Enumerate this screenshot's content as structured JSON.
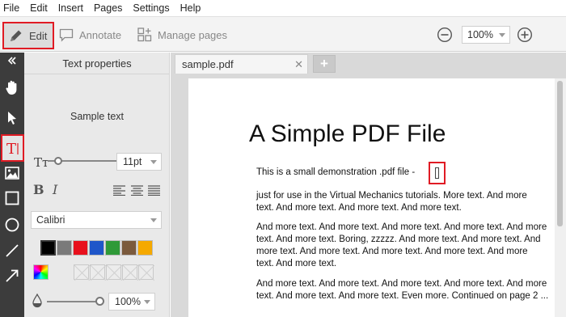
{
  "menubar": {
    "items": [
      "File",
      "Edit",
      "Insert",
      "Pages",
      "Settings",
      "Help"
    ]
  },
  "toolbar": {
    "edit_label": "Edit",
    "annotate_label": "Annotate",
    "manage_pages_label": "Manage pages",
    "zoom_value": "100%"
  },
  "panel": {
    "title": "Text properties",
    "sample_text": "Sample text",
    "font_size": "11pt",
    "font_name": "Calibri",
    "opacity": "100%",
    "swatches": [
      "#000000",
      "#7a7a7a",
      "#e8101c",
      "#1f56c9",
      "#2f9a38",
      "#7b5a3d",
      "#f5a900"
    ]
  },
  "tabs": {
    "file_name": "sample.pdf"
  },
  "document": {
    "title": "A Simple PDF File",
    "lines": [
      "This is a small demonstration .pdf file -",
      "just for use in the Virtual Mechanics tutorials. More text. And more",
      "text. And more text. And more text. And more text.",
      "And more text. And more text. And more text. And more text. And more",
      "text. And more text. Boring, zzzzz. And more text. And more text. And",
      "more text. And more text. And more text. And more text. And more",
      "text. And more text.",
      "And more text. And more text. And more text. And more text. And more",
      "text. And more text. And more text. Even more. Continued on page 2 ..."
    ]
  },
  "colors": {
    "highlight": "#e01b24",
    "rail": "#3c3c3c"
  }
}
